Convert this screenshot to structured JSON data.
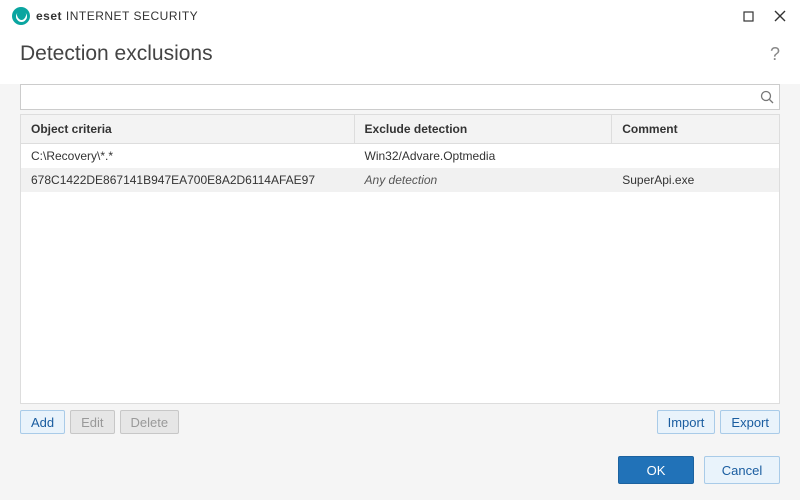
{
  "brand": {
    "bold": "eset",
    "rest": " INTERNET SECURITY"
  },
  "title": "Detection exclusions",
  "search": {
    "value": ""
  },
  "columns": {
    "object": "Object criteria",
    "detection": "Exclude detection",
    "comment": "Comment"
  },
  "rows": [
    {
      "object": "C:\\Recovery\\*.*",
      "detection": "Win32/Advare.Optmedia",
      "comment": "",
      "det_italic": false
    },
    {
      "object": "678C1422DE867141B947EA700E8A2D6114AFAE97",
      "detection": "Any detection",
      "comment": "SuperApi.exe",
      "det_italic": true
    }
  ],
  "actions": {
    "add": "Add",
    "edit": "Edit",
    "delete": "Delete",
    "import": "Import",
    "export": "Export"
  },
  "footer": {
    "ok": "OK",
    "cancel": "Cancel"
  }
}
